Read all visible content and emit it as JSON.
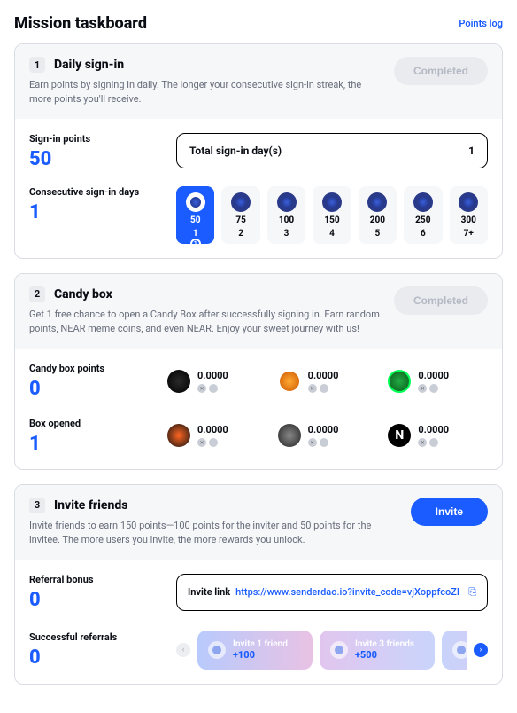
{
  "header": {
    "title": "Mission taskboard",
    "points_log": "Points log"
  },
  "signin": {
    "num": "1",
    "title": "Daily sign-in",
    "desc": "Earn points by signing in daily. The longer your consecutive sign-in streak, the more points you'll receive.",
    "btn": "Completed",
    "points_label": "Sign-in points",
    "points_value": "50",
    "total_label": "Total sign-in day(s)",
    "total_value": "1",
    "streak_label": "Consecutive sign-in days",
    "streak_value": "1",
    "tiers": [
      {
        "pts": "50",
        "day": "1",
        "active": true
      },
      {
        "pts": "75",
        "day": "2",
        "active": false
      },
      {
        "pts": "100",
        "day": "3",
        "active": false
      },
      {
        "pts": "150",
        "day": "4",
        "active": false
      },
      {
        "pts": "200",
        "day": "5",
        "active": false
      },
      {
        "pts": "250",
        "day": "6",
        "active": false
      },
      {
        "pts": "300",
        "day": "7+",
        "active": false
      }
    ]
  },
  "candy": {
    "num": "2",
    "title": "Candy box",
    "desc": "Get 1 free chance to open a Candy Box after successfully signing in. Earn random points, NEAR meme coins, and even NEAR. Enjoy your sweet journey with us!",
    "btn": "Completed",
    "points_label": "Candy box points",
    "points_value": "0",
    "opened_label": "Box opened",
    "opened_value": "1",
    "tokens": [
      {
        "amt": "0.0000",
        "cls": "ic1"
      },
      {
        "amt": "0.0000",
        "cls": "ic2"
      },
      {
        "amt": "0.0000",
        "cls": "ic3"
      },
      {
        "amt": "0.0000",
        "cls": "ic4"
      },
      {
        "amt": "0.0000",
        "cls": "ic5"
      },
      {
        "amt": "0.0000",
        "cls": "ic6",
        "letter": "N"
      }
    ]
  },
  "invite": {
    "num": "3",
    "title": "Invite friends",
    "desc": "Invite friends to earn 150 points—100 points for the inviter and 50 points for the invitee. The more users you invite, the more rewards you unlock.",
    "btn": "Invite",
    "bonus_label": "Referral bonus",
    "bonus_value": "0",
    "link_label": "Invite link",
    "link_url": "https://www.senderdao.io?invite_code=vjXoppfcoZI",
    "refs_label": "Successful referrals",
    "refs_value": "0",
    "milestones": [
      {
        "t": "Invite 1 friend",
        "p": "+100",
        "cls": "a"
      },
      {
        "t": "Invite 3 friends",
        "p": "+500",
        "cls": "b"
      },
      {
        "t": "",
        "p": "",
        "cls": "c"
      }
    ]
  }
}
